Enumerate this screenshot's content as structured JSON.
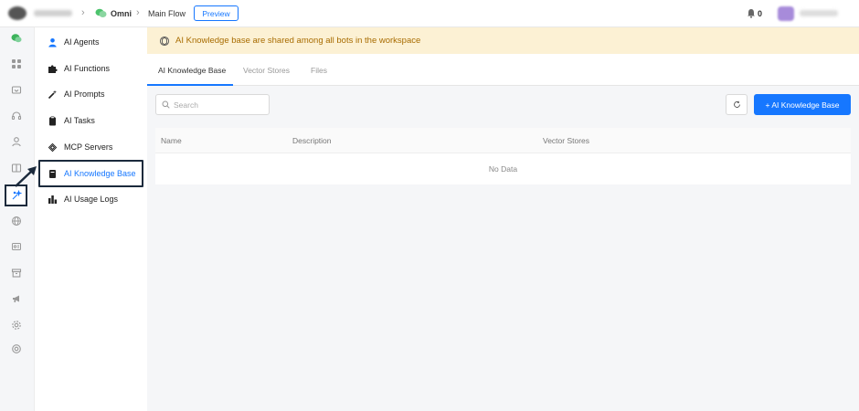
{
  "topbar": {
    "bot_name": "Omni",
    "flow_name": "Main Flow",
    "preview_label": "Preview",
    "notification_count": "0"
  },
  "subnav": {
    "items": [
      {
        "label": "AI Agents",
        "icon": "user-icon"
      },
      {
        "label": "AI Functions",
        "icon": "puzzle-icon"
      },
      {
        "label": "AI Prompts",
        "icon": "magic-wand-icon"
      },
      {
        "label": "AI Tasks",
        "icon": "clipboard-icon"
      },
      {
        "label": "MCP Servers",
        "icon": "mcp-icon"
      },
      {
        "label": "AI Knowledge Base",
        "icon": "book-icon",
        "active": true
      },
      {
        "label": "AI Usage Logs",
        "icon": "bar-chart-icon"
      }
    ]
  },
  "banner": {
    "text": "AI Knowledge base are shared among all bots in the workspace"
  },
  "tabs": [
    {
      "label": "AI Knowledge Base",
      "active": true
    },
    {
      "label": "Vector Stores",
      "active": false
    },
    {
      "label": "Files",
      "active": false
    }
  ],
  "search": {
    "placeholder": "Search",
    "value": ""
  },
  "add_button_label": "+ AI Knowledge Base",
  "table": {
    "columns": [
      "Name",
      "Description",
      "Vector Stores"
    ],
    "empty_text": "No Data"
  },
  "colors": {
    "accent": "#1677ff",
    "banner_bg": "#fcf1d4",
    "banner_text": "#a86c00",
    "highlight_border": "#1b2a3c"
  }
}
